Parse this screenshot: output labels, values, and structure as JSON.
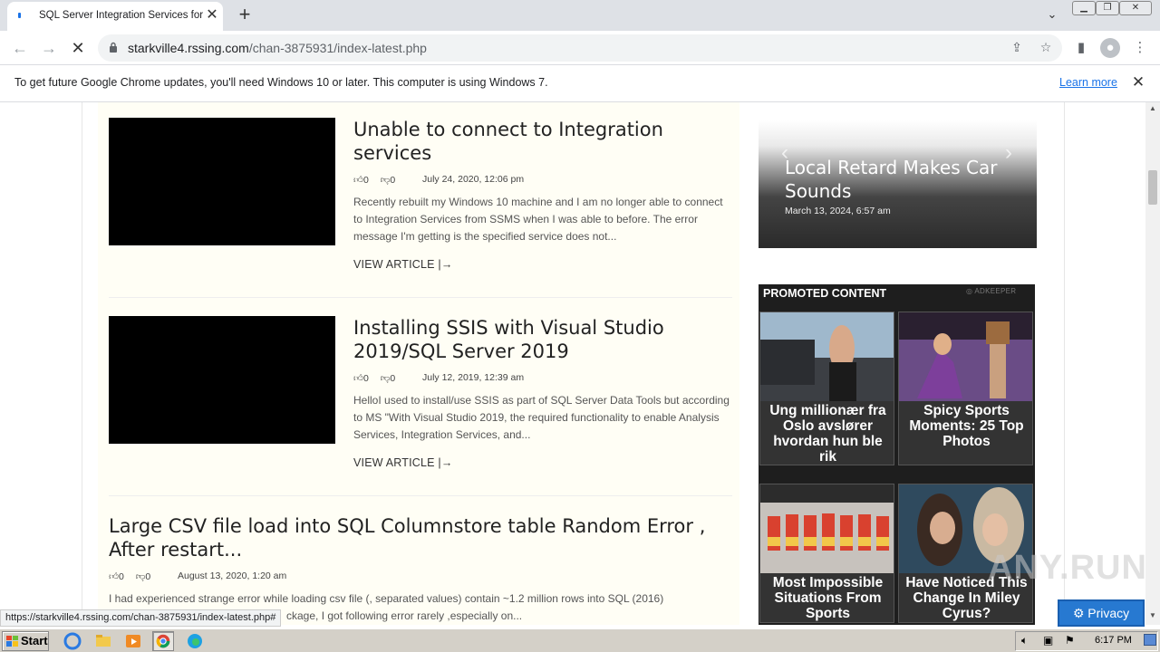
{
  "browser": {
    "tab_title": "SQL Server Integration Services for",
    "url_host": "starkville4.rssing.com",
    "url_path": "/chan-3875931/index-latest.php",
    "status_url": "https://starkville4.rssing.com/chan-3875931/index-latest.php#"
  },
  "infobar": {
    "message": "To get future Google Chrome updates, you'll need Windows 10 or later. This computer is using Windows 7.",
    "link": "Learn more"
  },
  "articles": [
    {
      "title": "Unable to connect to Integration services",
      "likes": "0",
      "dislikes": "0",
      "date": "July 24, 2020, 12:06 pm",
      "excerpt": "Recently rebuilt my Windows 10 machine and I am no longer able to connect to Integration Services from SSMS when I was able to before. The error message I'm getting is the specified service does not...",
      "view": "VIEW ARTICLE"
    },
    {
      "title": "Installing SSIS with Visual Studio 2019/SQL Server 2019",
      "likes": "0",
      "dislikes": "0",
      "date": "July 12, 2019, 12:39 am",
      "excerpt": "HelloI used to install/use SSIS as part of SQL Server Data Tools but according to MS \"With Visual Studio 2019, the required functionality to enable Analysis Services, Integration Services, and...",
      "view": "VIEW ARTICLE"
    },
    {
      "title": "Large CSV file load into SQL Columnstore table Random Error , After restart...",
      "likes": "0",
      "dislikes": "0",
      "date": "August 13, 2020, 1:20 am",
      "excerpt": "I had experienced strange error while loading csv file (, separated values) contain ~1.2 million rows into SQL (2016)",
      "excerpt2": "ckage, I got following error rarely ,especially on..."
    }
  ],
  "slider": {
    "title": "Local Retard Makes Car Sounds",
    "date": "March 13, 2024, 6:57 am"
  },
  "promo": {
    "heading": "PROMOTED CONTENT",
    "brand": "ADKEEPER",
    "cards": [
      {
        "caption": "Ung millionær fra Oslo avslører hvordan hun ble rik"
      },
      {
        "caption": "Spicy Sports Moments: 25 Top Photos"
      },
      {
        "caption": "Most Impossible Situations From Sports"
      },
      {
        "caption": "Have Noticed This Change In Miley Cyrus?"
      }
    ]
  },
  "privacy_label": "Privacy",
  "watermark": "ANY.RUN",
  "taskbar": {
    "start_label": "Start",
    "clock": "6:17 PM"
  }
}
